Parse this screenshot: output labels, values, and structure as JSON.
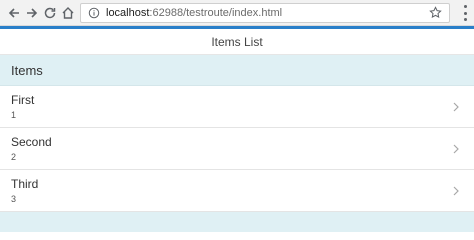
{
  "browser": {
    "url_host": "localhost",
    "url_rest": ":62988/testroute/index.html"
  },
  "header": {
    "title": "Items List"
  },
  "list": {
    "divider": "Items",
    "items": [
      {
        "title": "First",
        "subtitle": "1"
      },
      {
        "title": "Second",
        "subtitle": "2"
      },
      {
        "title": "Third",
        "subtitle": "3"
      }
    ]
  },
  "colors": {
    "accent": "#2a7fc9",
    "divider_bg": "#dff0f4"
  }
}
